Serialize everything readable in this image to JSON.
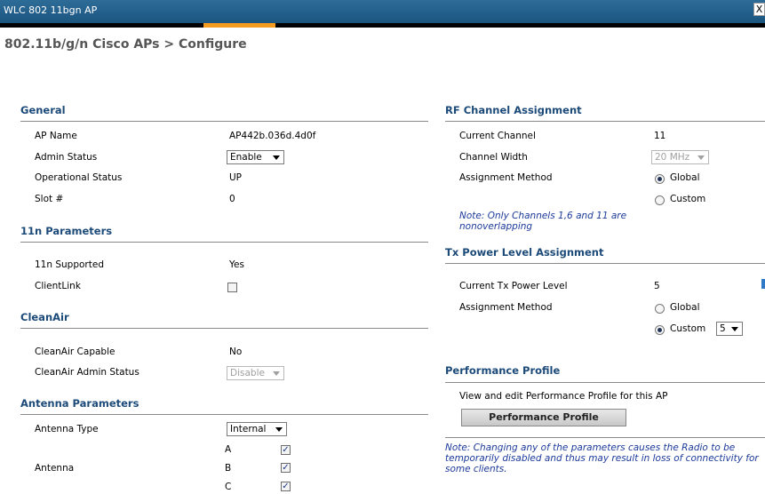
{
  "window": {
    "title": "WLC 802 11bgn AP",
    "close_glyph": "X"
  },
  "page_title": "802.11b/g/n Cisco APs > Configure",
  "general": {
    "heading": "General",
    "ap_name_label": "AP Name",
    "ap_name_value": "AP442b.036d.4d0f",
    "admin_status_label": "Admin Status",
    "admin_status_value": "Enable",
    "oper_status_label": "Operational Status",
    "oper_status_value": "UP",
    "slot_label": "Slot #",
    "slot_value": "0"
  },
  "n_params": {
    "heading": "11n Parameters",
    "supported_label": "11n Supported",
    "supported_value": "Yes",
    "clientlink_label": "ClientLink",
    "clientlink_checked": false
  },
  "cleanair": {
    "heading": "CleanAir",
    "capable_label": "CleanAir Capable",
    "capable_value": "No",
    "admin_label": "CleanAir Admin Status",
    "admin_value": "Disable"
  },
  "antenna": {
    "heading": "Antenna Parameters",
    "type_label": "Antenna Type",
    "type_value": "Internal",
    "antenna_label": "Antenna",
    "items": [
      {
        "name": "A",
        "checked": true
      },
      {
        "name": "B",
        "checked": true
      },
      {
        "name": "C",
        "checked": true
      }
    ],
    "check_glyph": "✓"
  },
  "rf": {
    "heading": "RF Channel Assignment",
    "current_label": "Current Channel",
    "current_value": "11",
    "width_label": "Channel Width",
    "width_value": "20 MHz",
    "method_label": "Assignment Method",
    "global_label": "Global",
    "custom_label": "Custom",
    "selected": "Global",
    "note": "Note: Only Channels 1,6 and 11 are nonoverlapping"
  },
  "tx": {
    "heading": "Tx Power Level Assignment",
    "current_label": "Current Tx Power Level",
    "current_value": "5",
    "method_label": "Assignment Method",
    "global_label": "Global",
    "custom_label": "Custom",
    "selected": "Custom",
    "custom_value": "5"
  },
  "perf": {
    "heading": "Performance Profile",
    "desc": "View and edit Performance Profile for this AP",
    "button_label": "Performance Profile"
  },
  "footer_note": "Note: Changing any of the parameters causes the Radio to be temporarily disabled and thus may result in loss of connectivity for some clients.",
  "colors": {
    "titlebar": "#1b5580",
    "section": "#1c4a79",
    "accent": "#f49b20",
    "note": "#1c3a9a"
  }
}
